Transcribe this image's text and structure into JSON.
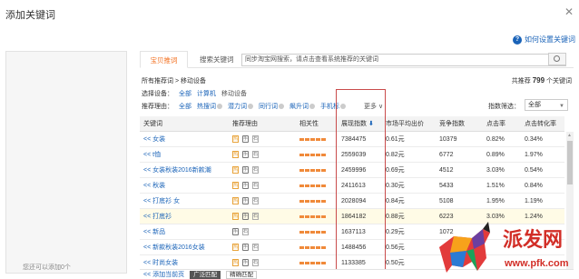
{
  "window": {
    "title": "添加关键词",
    "close_glyph": "✕"
  },
  "help": {
    "label": "如何设置关键词"
  },
  "left_panel": {
    "hint": "您还可以添加0个"
  },
  "tabs": [
    {
      "label": "宝贝推词",
      "active": true
    },
    {
      "label": "搜索关键词",
      "active": false
    }
  ],
  "search": {
    "placeholder": "同步淘宝网搜索，请点击查看系统推荐的关键词"
  },
  "breadcrumb": "所有推荐词 > 移动设备",
  "total": {
    "prefix": "共推荐",
    "count": "799",
    "suffix": "个关键词"
  },
  "filters": {
    "device_label": "选择设备：",
    "devices": [
      {
        "label": "全部",
        "selected": true
      },
      {
        "label": "计算机",
        "selected": false
      },
      {
        "label": "移动设备",
        "selected": false
      }
    ],
    "reason_label": "推荐理由：",
    "reason_all": "全部",
    "reasons": [
      "热搜词",
      "潜力词",
      "同行词",
      "飙升词",
      "手机标"
    ],
    "more": "更多 ∨",
    "index_label": "指数筛选：",
    "index_select": "全部"
  },
  "table": {
    "headers": {
      "keyword": "关键词",
      "reason": "推荐理由",
      "relevance": "相关性",
      "index": "展现指数",
      "sort_glyph": "⬇",
      "price": "市场平均出价",
      "competition": "竞争指数",
      "ctr": "点击率",
      "cvr": "点击转化率"
    },
    "rows": [
      {
        "keyword": "<< 女装",
        "reasons": [
          "热",
          "手",
          "石"
        ],
        "index": "7384475",
        "price": "0.61元",
        "competition": "10379",
        "ctr": "0.82%",
        "cvr": "0.34%",
        "highlight": false
      },
      {
        "keyword": "<< t恤",
        "reasons": [
          "热",
          "手",
          "石"
        ],
        "index": "2559039",
        "price": "0.82元",
        "competition": "6772",
        "ctr": "0.89%",
        "cvr": "1.97%",
        "highlight": false
      },
      {
        "keyword": "<< 女装秋装2016新款潮",
        "reasons": [
          "热",
          "手",
          "石"
        ],
        "index": "2459996",
        "price": "0.69元",
        "competition": "4512",
        "ctr": "3.03%",
        "cvr": "0.54%",
        "highlight": false
      },
      {
        "keyword": "<< 秋装",
        "reasons": [
          "热",
          "手",
          "石"
        ],
        "index": "2411613",
        "price": "0.30元",
        "competition": "5433",
        "ctr": "1.51%",
        "cvr": "0.84%",
        "highlight": false
      },
      {
        "keyword": "<< 打底衫 女",
        "reasons": [
          "热",
          "手",
          "石"
        ],
        "index": "2028094",
        "price": "0.84元",
        "competition": "5108",
        "ctr": "1.95%",
        "cvr": "1.19%",
        "highlight": false
      },
      {
        "keyword": "<< 打底衫",
        "reasons": [
          "热",
          "手",
          "石"
        ],
        "index": "1864182",
        "price": "0.88元",
        "competition": "6223",
        "ctr": "3.03%",
        "cvr": "1.24%",
        "highlight": true
      },
      {
        "keyword": "<< 新品",
        "reasons": [
          "手",
          "石"
        ],
        "index": "1637113",
        "price": "0.29元",
        "competition": "1072",
        "ctr": "",
        "cvr": "",
        "highlight": false
      },
      {
        "keyword": "<< 新款秋装2016女装",
        "reasons": [
          "热",
          "手",
          "石"
        ],
        "index": "1488456",
        "price": "0.56元",
        "competition": "",
        "ctr": "",
        "cvr": "",
        "highlight": false
      },
      {
        "keyword": "<< 时尚女装",
        "reasons": [
          "热",
          "手",
          "石"
        ],
        "index": "1133385",
        "price": "0.50元",
        "competition": "",
        "ctr": "",
        "cvr": "",
        "highlight": false
      }
    ]
  },
  "footer": {
    "add": "<< 添加当前页",
    "btn1": "广泛匹配",
    "btn2": "精确匹配"
  },
  "watermark": {
    "text": "派发网",
    "url": "www.pfk.com"
  },
  "colors": {
    "link": "#1a63b8",
    "accent": "#f37020",
    "highlight_box": "#c94b4b",
    "watermark": "#d22e27"
  }
}
